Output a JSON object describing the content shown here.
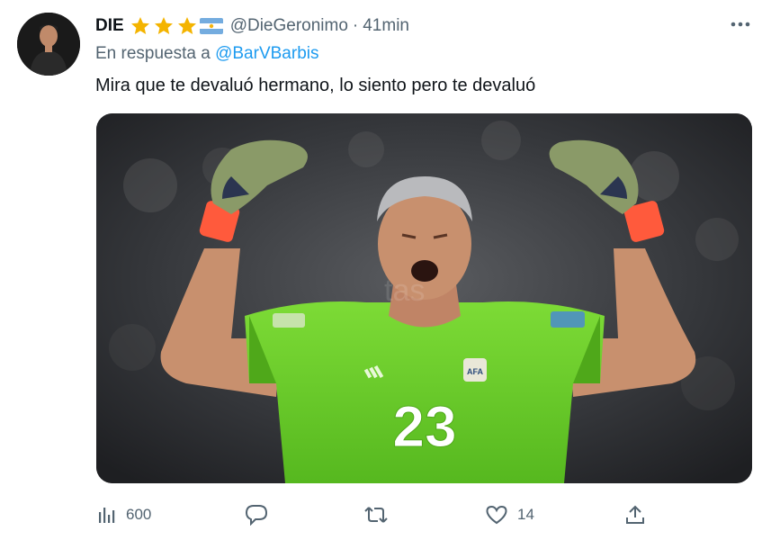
{
  "tweet": {
    "display_name": "DIE",
    "name_emoji": [
      "star",
      "star",
      "star",
      "argentina-flag"
    ],
    "handle": "@DieGeronimo",
    "separator": "·",
    "time": "41min",
    "reply_prefix": "En respuesta a ",
    "reply_to": "@BarVBarbis",
    "text": "Mira que te devaluó hermano, lo siento pero te devaluó",
    "media": {
      "description_icon": "goalkeeper-photo",
      "jersey_number": "23",
      "badge_text": "AFA",
      "watermark": "tas"
    }
  },
  "actions": {
    "views_icon": "analytics-icon",
    "views": "600",
    "reply_icon": "reply-icon",
    "retweet_icon": "retweet-icon",
    "like_icon": "heart-icon",
    "likes": "14",
    "share_icon": "share-icon"
  },
  "colors": {
    "text": "#0f1419",
    "secondary": "#536471",
    "link": "#1d9bf0",
    "star": "#f4b400",
    "jersey": "#6fcf2f"
  }
}
